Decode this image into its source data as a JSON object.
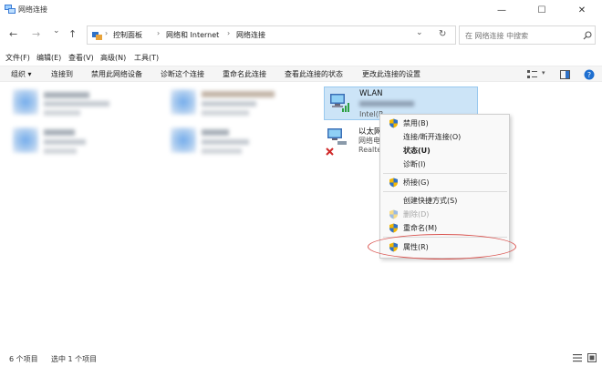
{
  "window": {
    "title": "网络连接",
    "controls": {
      "minimize": "—",
      "maximize": "☐",
      "close": "✕"
    }
  },
  "navigation": {
    "back": "←",
    "forward": "→",
    "dropdown": "⌄",
    "up": "↑",
    "refresh": "↻",
    "addr_dropdown": "⌄",
    "sep": "›"
  },
  "address_bar": {
    "crumbs": [
      "控制面板",
      "网络和 Internet",
      "网络连接"
    ]
  },
  "search": {
    "placeholder": "在 网络连接 中搜索"
  },
  "menu": [
    "文件(F)",
    "编辑(E)",
    "查看(V)",
    "高级(N)",
    "工具(T)"
  ],
  "toolbar": {
    "organize": "组织 ▾",
    "items": [
      "连接到",
      "禁用此网络设备",
      "诊断这个连接",
      "重命名此连接",
      "查看此连接的状态",
      "更改此连接的设置"
    ]
  },
  "connections": {
    "wlan": {
      "name": "WLAN",
      "adapter": "Intel(R"
    },
    "ethernet": {
      "name": "以太网",
      "status": "网络电",
      "adapter": "Realte"
    }
  },
  "context_menu": {
    "items": [
      {
        "label": "禁用(B)",
        "icon": "shield-icon"
      },
      {
        "label": "连接/断开连接(O)"
      },
      {
        "label": "状态(U)",
        "bold": true
      },
      {
        "label": "诊断(I)"
      },
      {
        "label": "桥接(G)",
        "icon": "shield-icon"
      },
      {
        "label": "创建快捷方式(S)"
      },
      {
        "label": "删除(D)",
        "icon": "shield-icon",
        "disabled": true
      },
      {
        "label": "重命名(M)",
        "icon": "shield-icon"
      },
      {
        "label": "属性(R)",
        "icon": "shield-icon"
      }
    ]
  },
  "status_bar": {
    "count": "6 个项目",
    "selected": "选中 1 个项目"
  },
  "colors": {
    "selection": "#cce4f7",
    "highlight_ring": "#d9534f",
    "accent": "#0078d4"
  }
}
